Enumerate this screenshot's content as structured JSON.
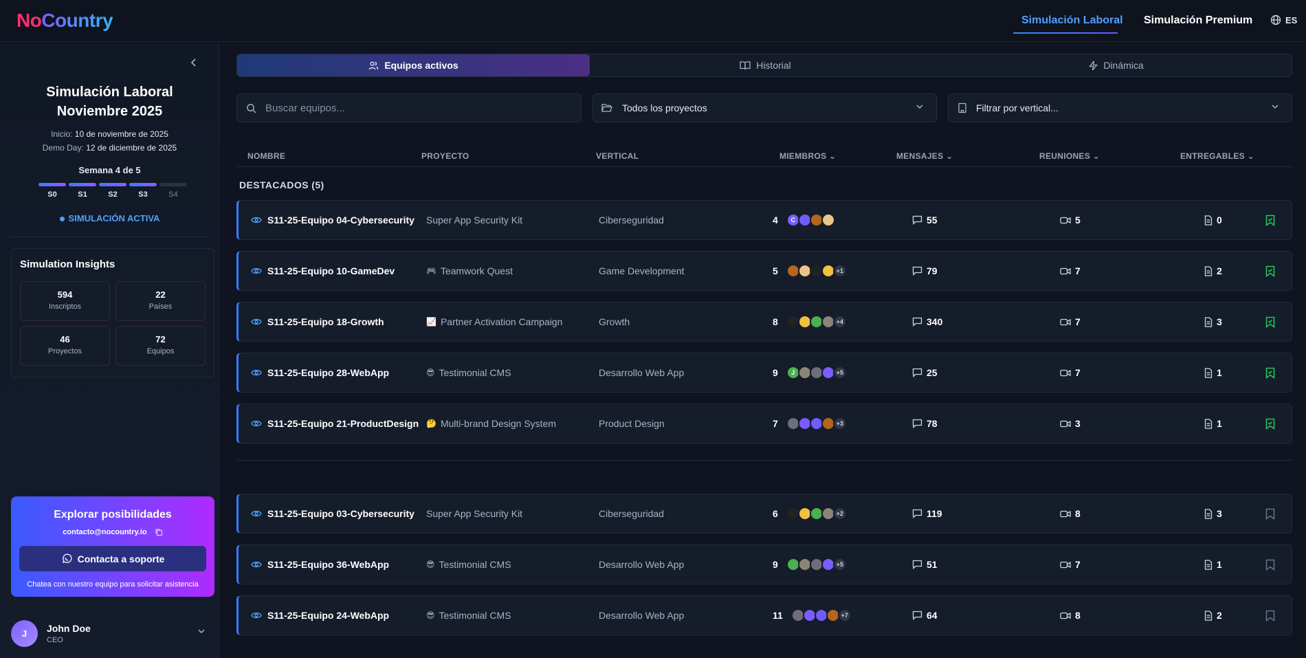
{
  "header": {
    "logo_no": "No",
    "logo_country": "Country",
    "nav": [
      "Simulación Laboral",
      "Simulación Premium"
    ],
    "lang": "ES"
  },
  "sidebar": {
    "title_line1": "Simulación Laboral",
    "title_line2": "Noviembre 2025",
    "start_label": "Inicio:",
    "start_value": "10 de noviembre de 2025",
    "demo_label": "Demo Day:",
    "demo_value": "12 de diciembre de 2025",
    "week": "Semana 4 de 5",
    "weeks": [
      {
        "label": "S0",
        "done": true
      },
      {
        "label": "S1",
        "done": true
      },
      {
        "label": "S2",
        "done": true
      },
      {
        "label": "S3",
        "done": true
      },
      {
        "label": "S4",
        "done": false
      }
    ],
    "status": "SIMULACIÓN ACTIVA",
    "insights": {
      "title": "Simulation Insights",
      "stats": [
        {
          "value": "594",
          "label": "Inscriptos"
        },
        {
          "value": "22",
          "label": "Países"
        },
        {
          "value": "46",
          "label": "Proyectos"
        },
        {
          "value": "72",
          "label": "Equipos"
        }
      ]
    },
    "explore": {
      "title": "Explorar posibilidades",
      "email": "contacto@nocountry.io",
      "button": "Contacta a soporte",
      "note": "Chatea con nuestro equipo para solicitar asistencia"
    },
    "user": {
      "initial": "J",
      "name": "John Doe",
      "role": "CEO"
    }
  },
  "tabs": [
    "Equipos activos",
    "Historial",
    "Dinámica"
  ],
  "filters": {
    "search_placeholder": "Buscar equipos...",
    "project": "Todos los proyectos",
    "vertical": "Filtrar por vertical..."
  },
  "table": {
    "columns": [
      "NOMBRE",
      "PROYECTO",
      "VERTICAL",
      "MIEMBROS",
      "MENSAJES",
      "REUNIONES",
      "ENTREGABLES"
    ],
    "featured_label": "DESTACADOS (5)",
    "featured_rows": [
      {
        "name": "S11-25-Equipo 04-Cybersecurity",
        "project_icon": "",
        "project": "Super App Security Kit",
        "vertical": "Ciberseguridad",
        "members": "4",
        "avatars": [
          "c",
          "",
          "",
          ""
        ],
        "more": "",
        "messages": "55",
        "meetings": "5",
        "deliverables": "0",
        "bookmarked": true
      },
      {
        "name": "S11-25-Equipo 10-GameDev",
        "project_icon": "🎮",
        "project": "Teamwork Quest",
        "vertical": "Game Development",
        "members": "5",
        "avatars": [
          "",
          "",
          "",
          ""
        ],
        "more": "+1",
        "messages": "79",
        "meetings": "7",
        "deliverables": "2",
        "bookmarked": true
      },
      {
        "name": "S11-25-Equipo 18-Growth",
        "project_icon": "📈",
        "project": "Partner Activation Campaign",
        "vertical": "Growth",
        "members": "8",
        "avatars": [
          "",
          "",
          "",
          ""
        ],
        "more": "+4",
        "messages": "340",
        "meetings": "7",
        "deliverables": "3",
        "bookmarked": true
      },
      {
        "name": "S11-25-Equipo 28-WebApp",
        "project_icon": "😎",
        "project": "Testimonial CMS",
        "vertical": "Desarrollo Web App",
        "members": "9",
        "avatars": [
          "J",
          "",
          "",
          ""
        ],
        "more": "+5",
        "messages": "25",
        "meetings": "7",
        "deliverables": "1",
        "bookmarked": true
      },
      {
        "name": "S11-25-Equipo 21-ProductDesign",
        "project_icon": "🤔",
        "project": "Multi-brand Design System",
        "vertical": "Product Design",
        "members": "7",
        "avatars": [
          "",
          "",
          "",
          ""
        ],
        "more": "+3",
        "messages": "78",
        "meetings": "3",
        "deliverables": "1",
        "bookmarked": true
      }
    ],
    "rows": [
      {
        "name": "S11-25-Equipo 03-Cybersecurity",
        "project_icon": "",
        "project": "Super App Security Kit",
        "vertical": "Ciberseguridad",
        "members": "6",
        "avatars": [
          "",
          "",
          "",
          ""
        ],
        "more": "+2",
        "messages": "119",
        "meetings": "8",
        "deliverables": "3",
        "bookmarked": false
      },
      {
        "name": "S11-25-Equipo 36-WebApp",
        "project_icon": "😎",
        "project": "Testimonial CMS",
        "vertical": "Desarrollo Web App",
        "members": "9",
        "avatars": [
          "",
          "",
          "",
          ""
        ],
        "more": "+5",
        "messages": "51",
        "meetings": "7",
        "deliverables": "1",
        "bookmarked": false
      },
      {
        "name": "S11-25-Equipo 24-WebApp",
        "project_icon": "😎",
        "project": "Testimonial CMS",
        "vertical": "Desarrollo Web App",
        "members": "11",
        "avatars": [
          "",
          "",
          "",
          ""
        ],
        "more": "+7",
        "messages": "64",
        "meetings": "8",
        "deliverables": "2",
        "bookmarked": false
      }
    ]
  },
  "colors": {
    "accent": "#4ea1ff",
    "bookmark_on": "#22c55e",
    "bookmark_off": "#6b7385",
    "row_border": "#3a7bff",
    "avatar_fills": [
      "#4caf50",
      "#8d8478",
      "#6e6e7a",
      "#7a5cff",
      "#6f5cff",
      "#b5651d",
      "#e8c58a",
      "#222222",
      "#f0c040"
    ]
  }
}
